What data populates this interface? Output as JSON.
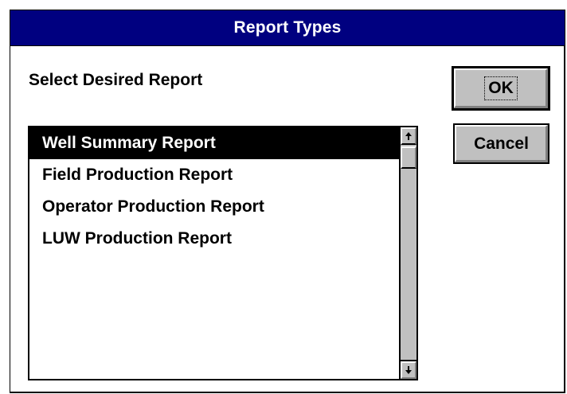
{
  "window": {
    "title": "Report Types",
    "title_bar_color": "#000080"
  },
  "prompt": "Select Desired Report",
  "report_list": {
    "selected_index": 0,
    "items": [
      "Well Summary Report",
      "Field Production Report",
      "Operator Production Report",
      "LUW Production Report"
    ]
  },
  "buttons": {
    "ok_label": "OK",
    "cancel_label": "Cancel"
  },
  "icons": {
    "scroll_up": "arrow-up-icon",
    "scroll_down": "arrow-down-icon"
  }
}
